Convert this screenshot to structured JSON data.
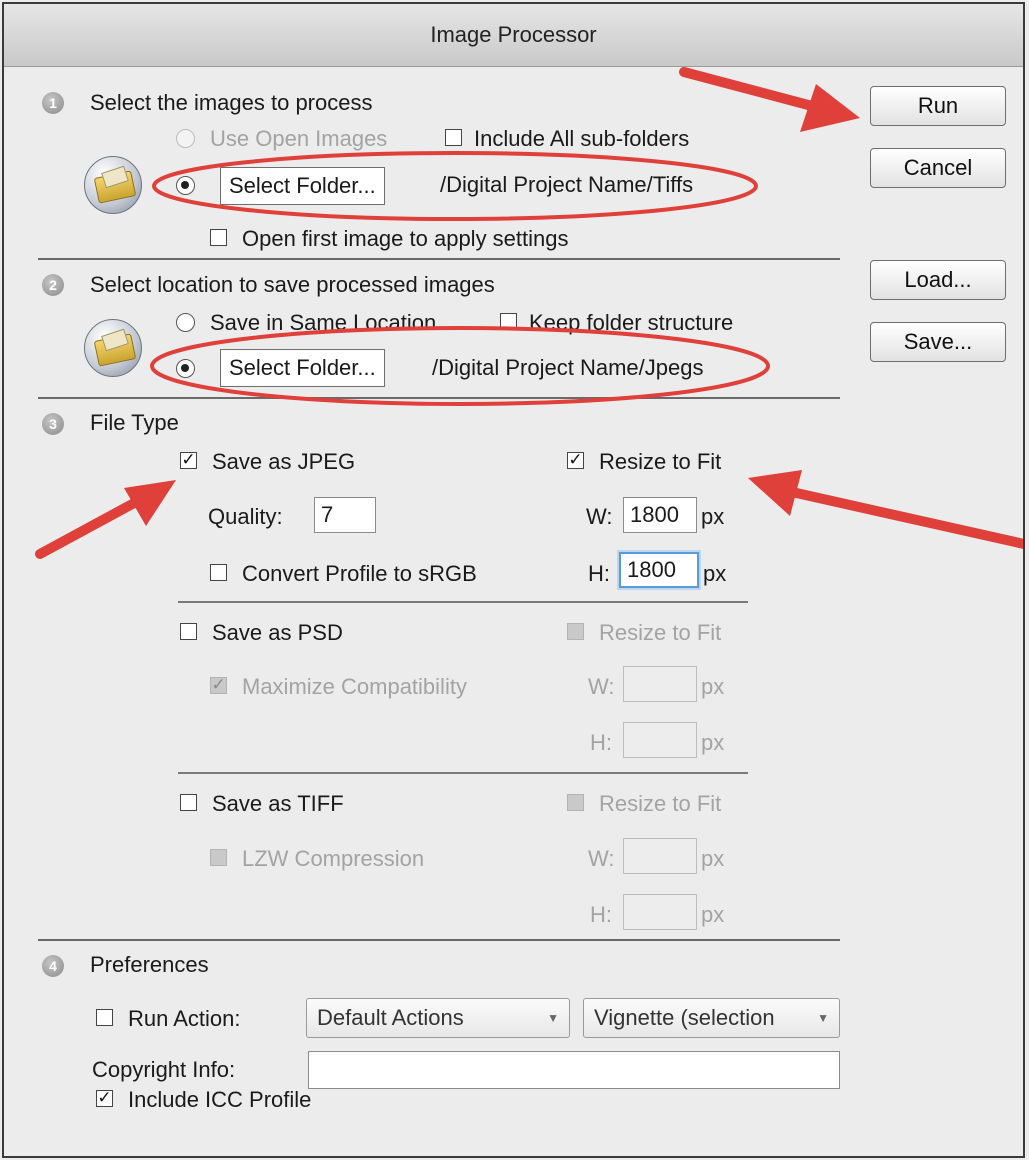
{
  "window": {
    "title": "Image Processor"
  },
  "steps": {
    "s1": "1",
    "s2": "2",
    "s3": "3",
    "s4": "4"
  },
  "section1": {
    "heading": "Select the images to process",
    "use_open_images": "Use Open Images",
    "include_subfolders": "Include All sub-folders",
    "select_folder": "Select Folder...",
    "folder_path": "/Digital Project Name/Tiffs",
    "open_first_image": "Open first image to apply settings"
  },
  "section2": {
    "heading": "Select location to save processed images",
    "save_same_location": "Save in Same Location",
    "keep_folder_structure": "Keep folder structure",
    "select_folder": "Select Folder...",
    "folder_path": "/Digital Project Name/Jpegs"
  },
  "section3": {
    "heading": "File Type",
    "jpeg": {
      "save_as": "Save as JPEG",
      "resize": "Resize to Fit",
      "quality_label": "Quality:",
      "quality_value": "7",
      "w_label": "W:",
      "w_value": "1800",
      "h_label": "H:",
      "h_value": "1800",
      "unit": "px",
      "convert_profile": "Convert Profile to sRGB"
    },
    "psd": {
      "save_as": "Save as PSD",
      "resize": "Resize to Fit",
      "maximize": "Maximize Compatibility",
      "w_label": "W:",
      "h_label": "H:",
      "unit": "px"
    },
    "tiff": {
      "save_as": "Save as TIFF",
      "resize": "Resize to Fit",
      "lzw": "LZW Compression",
      "w_label": "W:",
      "h_label": "H:",
      "unit": "px"
    }
  },
  "section4": {
    "heading": "Preferences",
    "run_action": "Run Action:",
    "action_set": "Default Actions",
    "action": "Vignette (selection",
    "copyright_label": "Copyright Info:",
    "copyright_value": "",
    "include_icc": "Include ICC Profile"
  },
  "buttons": {
    "run": "Run",
    "cancel": "Cancel",
    "load": "Load...",
    "save": "Save..."
  },
  "icons": {
    "step_badge": "numbered-circle-icon",
    "folder": "folder-icon",
    "checkbox_checked": "✓",
    "dropdown": "▼"
  },
  "colors": {
    "annotation": "#e0403a",
    "focus": "#5b9ad6",
    "disabled_text": "#a3a3a3"
  }
}
